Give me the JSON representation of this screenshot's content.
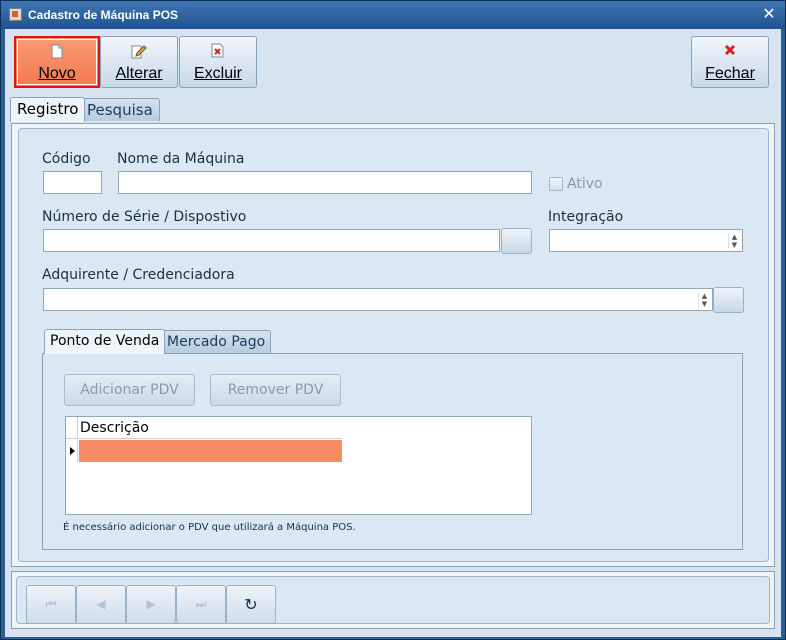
{
  "window": {
    "title": "Cadastro de Máquina POS"
  },
  "toolbar": {
    "novo": "Novo",
    "alterar": "Alterar",
    "excluir": "Excluir",
    "fechar": "Fechar"
  },
  "tabs": [
    "Registro",
    "Pesquisa"
  ],
  "form": {
    "codigo_label": "Código",
    "codigo_value": "",
    "nome_label": "Nome da Máquina",
    "nome_value": "",
    "ativo_label": "Ativo",
    "serie_label": "Número de Série / Dispostivo",
    "serie_value": "",
    "integracao_label": "Integração",
    "integracao_value": "",
    "adquirente_label": "Adquirente / Credenciadora",
    "adquirente_value": ""
  },
  "subtabs": [
    "Ponto de Venda",
    "Mercado Pago"
  ],
  "pdv": {
    "adicionar": "Adicionar PDV",
    "remover": "Remover PDV",
    "column": "Descrição",
    "note": "É necessário adicionar o PDV que utilizará a Máquina POS."
  },
  "colors": {
    "accent": "#f37a4c",
    "selected_row": "#f78b64",
    "border_active": "#e01414"
  }
}
